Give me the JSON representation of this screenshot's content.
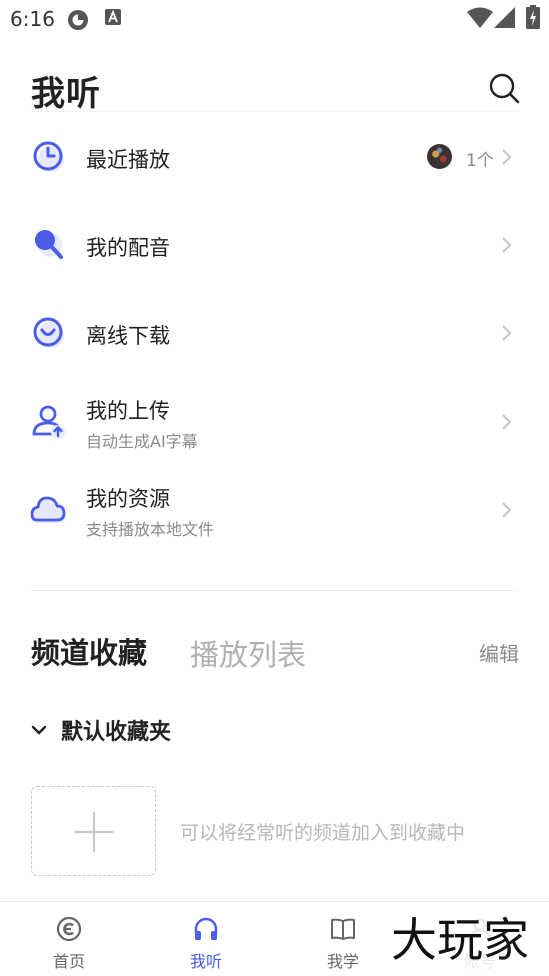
{
  "status_bar": {
    "time": "6:16"
  },
  "header": {
    "title": "我听"
  },
  "menu": [
    {
      "label": "最近播放",
      "count": "1个"
    },
    {
      "label": "我的配音"
    },
    {
      "label": "离线下载"
    },
    {
      "label": "我的上传",
      "subtitle": "自动生成AI字幕"
    },
    {
      "label": "我的资源",
      "subtitle": "支持播放本地文件"
    }
  ],
  "collection": {
    "tabs": [
      "频道收藏",
      "播放列表"
    ],
    "edit_label": "编辑",
    "folder_title": "默认收藏夹",
    "add_hint": "可以将经常听的频道加入到收藏中"
  },
  "bottom_nav": [
    {
      "label": "首页",
      "icon": "home-icon"
    },
    {
      "label": "我听",
      "icon": "headphones-icon",
      "active": true
    },
    {
      "label": "我学",
      "icon": "book-icon"
    },
    {
      "label": "账号",
      "icon": "account-icon"
    }
  ],
  "watermark": {
    "text": "大玩家"
  },
  "colors": {
    "accent": "#4a5ce8",
    "text": "#222222",
    "muted": "#8a8a8a"
  }
}
